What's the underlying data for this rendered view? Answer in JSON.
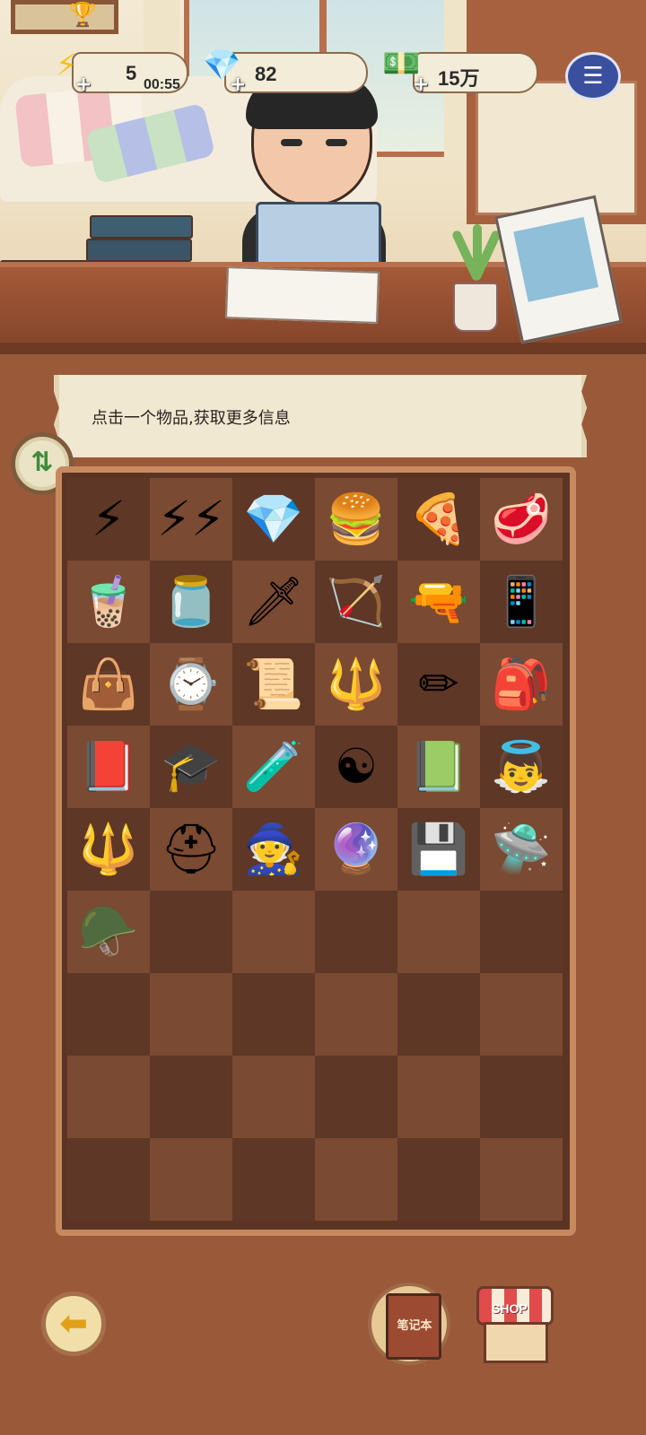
{
  "hud": {
    "energy": {
      "value": "5",
      "timer": "00:55",
      "icon": "lightning-icon",
      "plus": "+"
    },
    "gems": {
      "value": "82",
      "icon": "purple-gem-icon",
      "plus": "+"
    },
    "money": {
      "value": "15万",
      "icon": "cash-stack-icon",
      "plus": "+"
    },
    "menu_icon": "notes-menu-icon"
  },
  "banner": {
    "text": "点击一个物品,获取更多信息"
  },
  "sort_button": {
    "icon": "sort-arrows-icon",
    "glyph": "⇅"
  },
  "notebook_button": {
    "label": "笔记本"
  },
  "shop_button": {
    "label": "SHOP"
  },
  "back_button": {
    "icon": "back-arrow-icon",
    "glyph": "⬅"
  },
  "inventory": {
    "columns": 6,
    "rows": 9,
    "items": [
      {
        "name": "lightning-bolt-item",
        "glyph": "⚡"
      },
      {
        "name": "triple-lightning-item",
        "glyph": "⚡⚡"
      },
      {
        "name": "purple-gem-item",
        "glyph": "💎"
      },
      {
        "name": "burger-item",
        "glyph": "🍔"
      },
      {
        "name": "pizza-slice-item",
        "glyph": "🍕"
      },
      {
        "name": "steak-item",
        "glyph": "🥩"
      },
      {
        "name": "bubble-tea-item",
        "glyph": "🧋"
      },
      {
        "name": "juice-jar-item",
        "glyph": "🫙"
      },
      {
        "name": "sword-item",
        "glyph": "🗡"
      },
      {
        "name": "bow-item",
        "glyph": "🏹"
      },
      {
        "name": "pistol-item",
        "glyph": "🔫"
      },
      {
        "name": "walkie-phone-item",
        "glyph": "📱"
      },
      {
        "name": "briefcase-item",
        "glyph": "👜"
      },
      {
        "name": "wristwatch-item",
        "glyph": "⌚"
      },
      {
        "name": "scroll-item",
        "glyph": "📜"
      },
      {
        "name": "spear-item",
        "glyph": "🔱"
      },
      {
        "name": "pencil-item",
        "glyph": "✏"
      },
      {
        "name": "backpack-item",
        "glyph": "🎒"
      },
      {
        "name": "textbook-item",
        "glyph": "📕"
      },
      {
        "name": "graduation-cap-item",
        "glyph": "🎓"
      },
      {
        "name": "potion-bottle-item",
        "glyph": "🧪"
      },
      {
        "name": "bagua-mirror-item",
        "glyph": "☯"
      },
      {
        "name": "talisman-item",
        "glyph": "📗"
      },
      {
        "name": "angel-wings-item",
        "glyph": "👼"
      },
      {
        "name": "trident-item",
        "glyph": "🔱"
      },
      {
        "name": "viking-helmet-item",
        "glyph": "⛑"
      },
      {
        "name": "wizard-hat-item",
        "glyph": "🧙"
      },
      {
        "name": "crystal-ball-item",
        "glyph": "🔮"
      },
      {
        "name": "computer-chip-item",
        "glyph": "💾"
      },
      {
        "name": "drone-item",
        "glyph": "🛸"
      },
      {
        "name": "stormtrooper-helmet-item",
        "glyph": "🪖"
      }
    ]
  },
  "colors": {
    "panel_bg": "#9a5a3a",
    "grid_dark": "#5e3726",
    "grid_light": "#7a4a32",
    "grid_border": "#c78a5e",
    "banner_bg": "#f1e8d1",
    "sort_green": "#3f8b3b",
    "menu_blue": "#3a4f9e"
  }
}
